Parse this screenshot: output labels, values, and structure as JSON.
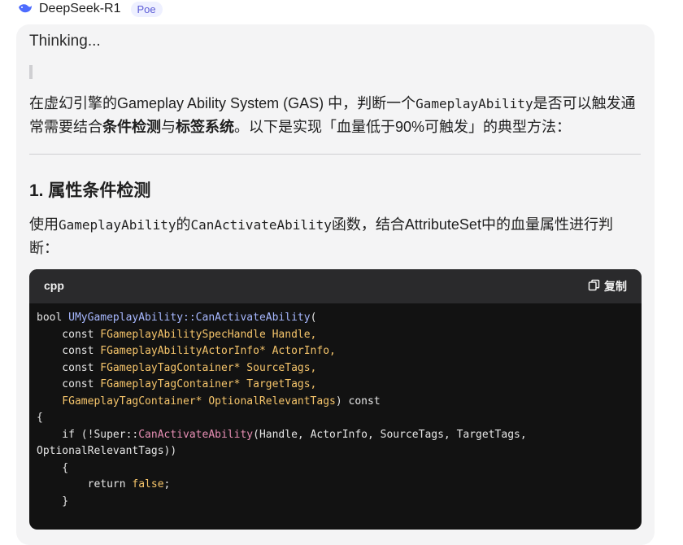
{
  "header": {
    "bot_name": "DeepSeek-R1",
    "badge": "Poe",
    "icon": "whale-icon"
  },
  "message": {
    "thinking_label": "Thinking...",
    "intro": {
      "p1": "在虚幻引擎的Gameplay Ability System (GAS) 中，判断一个",
      "code1": "GameplayAbility",
      "p2": "是否可以触发通常需要结合",
      "b1": "条件检测",
      "p3": "与",
      "b2": "标签系统",
      "p4": "。以下是实现「血量低于90%可触发」的典型方法："
    },
    "section1_title": "1. 属性条件检测",
    "section1_text": {
      "p1": "使用",
      "code1": "GameplayAbility",
      "p2": "的",
      "code2": "CanActivateAbility",
      "p3": "函数，结合AttributeSet中的血量属性进行判断："
    },
    "code": {
      "lang": "cpp",
      "copy_label": "复制",
      "lines": [
        [
          [
            "plain",
            "bool "
          ],
          [
            "fn",
            "UMyGameplayAbility::CanActivateAbility"
          ],
          [
            "plain",
            "("
          ]
        ],
        [
          [
            "plain",
            "    const "
          ],
          [
            "type",
            "FGameplayAbilitySpecHandle Handle,"
          ]
        ],
        [
          [
            "plain",
            "    const "
          ],
          [
            "type",
            "FGameplayAbilityActorInfo* ActorInfo,"
          ]
        ],
        [
          [
            "plain",
            "    const "
          ],
          [
            "type",
            "FGameplayTagContainer* SourceTags,"
          ]
        ],
        [
          [
            "plain",
            "    const "
          ],
          [
            "type",
            "FGameplayTagContainer* TargetTags,"
          ]
        ],
        [
          [
            "type",
            "    FGameplayTagContainer* OptionalRelevantTags"
          ],
          [
            "plain",
            ") const"
          ]
        ],
        [
          [
            "plain",
            "{"
          ]
        ],
        [
          [
            "plain",
            "    if (!Super::"
          ],
          [
            "call",
            "CanActivateAbility"
          ],
          [
            "plain",
            "(Handle, ActorInfo, SourceTags, TargetTags,"
          ]
        ],
        [
          [
            "plain",
            "OptionalRelevantTags))"
          ]
        ],
        [
          [
            "plain",
            "    {"
          ]
        ],
        [
          [
            "plain",
            "        return "
          ],
          [
            "type",
            "false"
          ],
          [
            "plain",
            ";"
          ]
        ],
        [
          [
            "plain",
            "    }"
          ]
        ]
      ]
    }
  },
  "colors": {
    "bubble_bg": "#f4f4f5",
    "code_bg": "#121212",
    "code_header_bg": "#2a2a2c",
    "badge_fg": "#5b5bd6"
  }
}
